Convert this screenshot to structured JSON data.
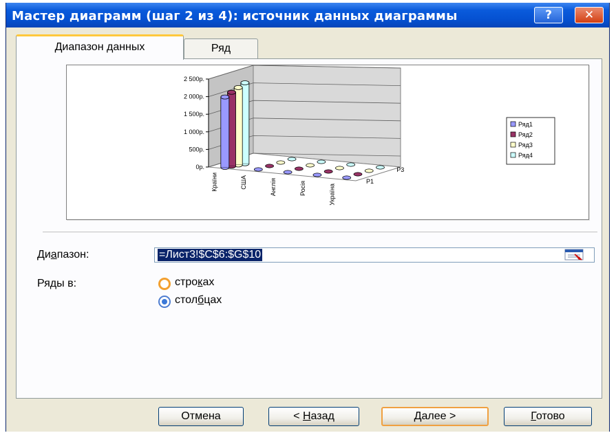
{
  "window": {
    "title": "Мастер диаграмм (шаг 2 из 4): источник данных диаграммы",
    "help_label": "?",
    "close_label": "✕"
  },
  "tabs": [
    {
      "label": "Диапазон данных",
      "active": true
    },
    {
      "label": "Ряд",
      "active": false
    }
  ],
  "range": {
    "label_pre": "Ди",
    "label_u": "а",
    "label_post": "пазон:",
    "value": "=Лист3!$C$6:$G$10"
  },
  "series_in": {
    "label": "Ряды в:",
    "rows": {
      "pre": "стро",
      "u": "к",
      "post": "ах",
      "selected": false
    },
    "cols": {
      "pre": "стол",
      "u": "б",
      "post": "цах",
      "selected": true
    }
  },
  "buttons": {
    "cancel": "Отмена",
    "back": {
      "pre": "< ",
      "u": "Н",
      "post": "азад"
    },
    "next": {
      "u": "Д",
      "post": "алее >"
    },
    "finish": {
      "u": "Г",
      "post": "отово"
    }
  },
  "chart_data": {
    "type": "bar",
    "subtype": "3d-column",
    "categories": [
      "Країни",
      "США",
      "Англія",
      "Росія",
      "Україна"
    ],
    "depth_labels": [
      "Р3",
      "Р1"
    ],
    "y_ticks": [
      "2 500р.",
      "2 000р.",
      "1 500р.",
      "1 000р.",
      "500р.",
      "0р."
    ],
    "ylim": [
      0,
      2500
    ],
    "series": [
      {
        "name": "Ряд1",
        "color": "#9999ff",
        "values": [
          2000,
          0,
          0,
          0,
          0
        ]
      },
      {
        "name": "Ряд2",
        "color": "#993366",
        "values": [
          2100,
          0,
          0,
          0,
          0
        ]
      },
      {
        "name": "Ряд3",
        "color": "#ffffcc",
        "values": [
          2200,
          0,
          0,
          0,
          0
        ]
      },
      {
        "name": "Ряд4",
        "color": "#ccffff",
        "values": [
          2300,
          0,
          0,
          0,
          0
        ]
      }
    ],
    "legend_position": "right"
  }
}
